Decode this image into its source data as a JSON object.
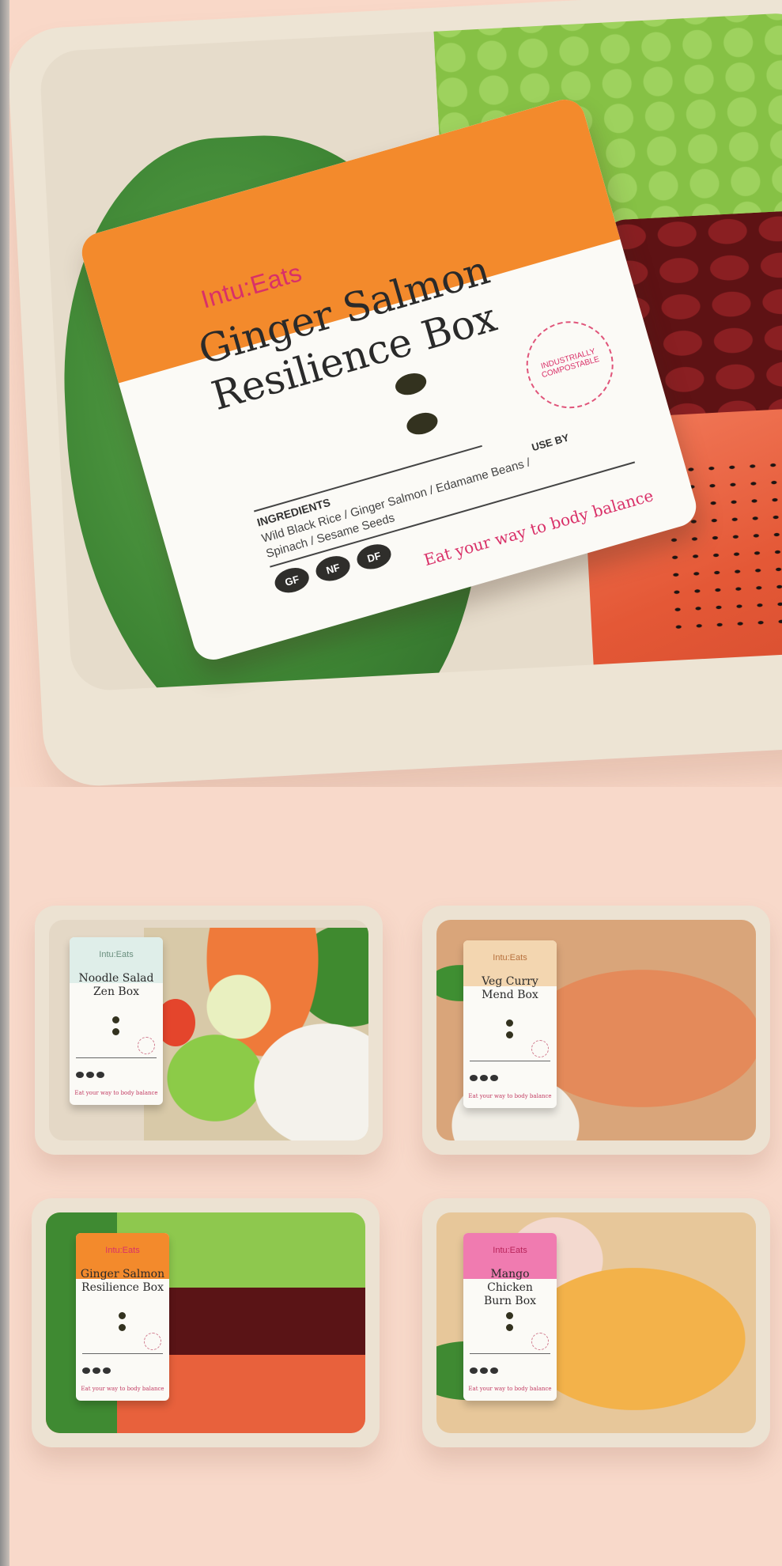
{
  "hero": {
    "brand": "Intu:Eats",
    "title_line1": "Ginger Salmon",
    "title_line2": "Resilience Box",
    "seal_text": "INDUSTRIALLY COMPOSTABLE",
    "ingredients_heading": "INGREDIENTS",
    "ingredients": "Wild Black Rice / Ginger Salmon / Edamame Beans / Spinach / Sesame Seeds",
    "use_by": "USE BY",
    "badges": [
      "GF",
      "NF",
      "DF"
    ],
    "slogan": "Eat your way to body balance",
    "band_color": "#f38a2c"
  },
  "boxes": [
    {
      "brand": "Intu:Eats",
      "title_line1": "Noodle Salad",
      "title_line2": "Zen Box",
      "band_color": "#dfeee9",
      "slogan": "Eat your way to body balance"
    },
    {
      "brand": "Intu:Eats",
      "title_line1": "Veg Curry",
      "title_line2": "Mend Box",
      "band_color": "#f3d6b0",
      "slogan": "Eat your way to body balance"
    },
    {
      "brand": "Intu:Eats",
      "title_line1": "Ginger Salmon",
      "title_line2": "Resilience Box",
      "band_color": "#f38a2c",
      "slogan": "Eat your way to body balance"
    },
    {
      "brand": "Intu:Eats",
      "title_line1": "Mango Chicken",
      "title_line2": "Burn Box",
      "band_color": "#f07bb0",
      "slogan": "Eat your way to body balance"
    }
  ]
}
